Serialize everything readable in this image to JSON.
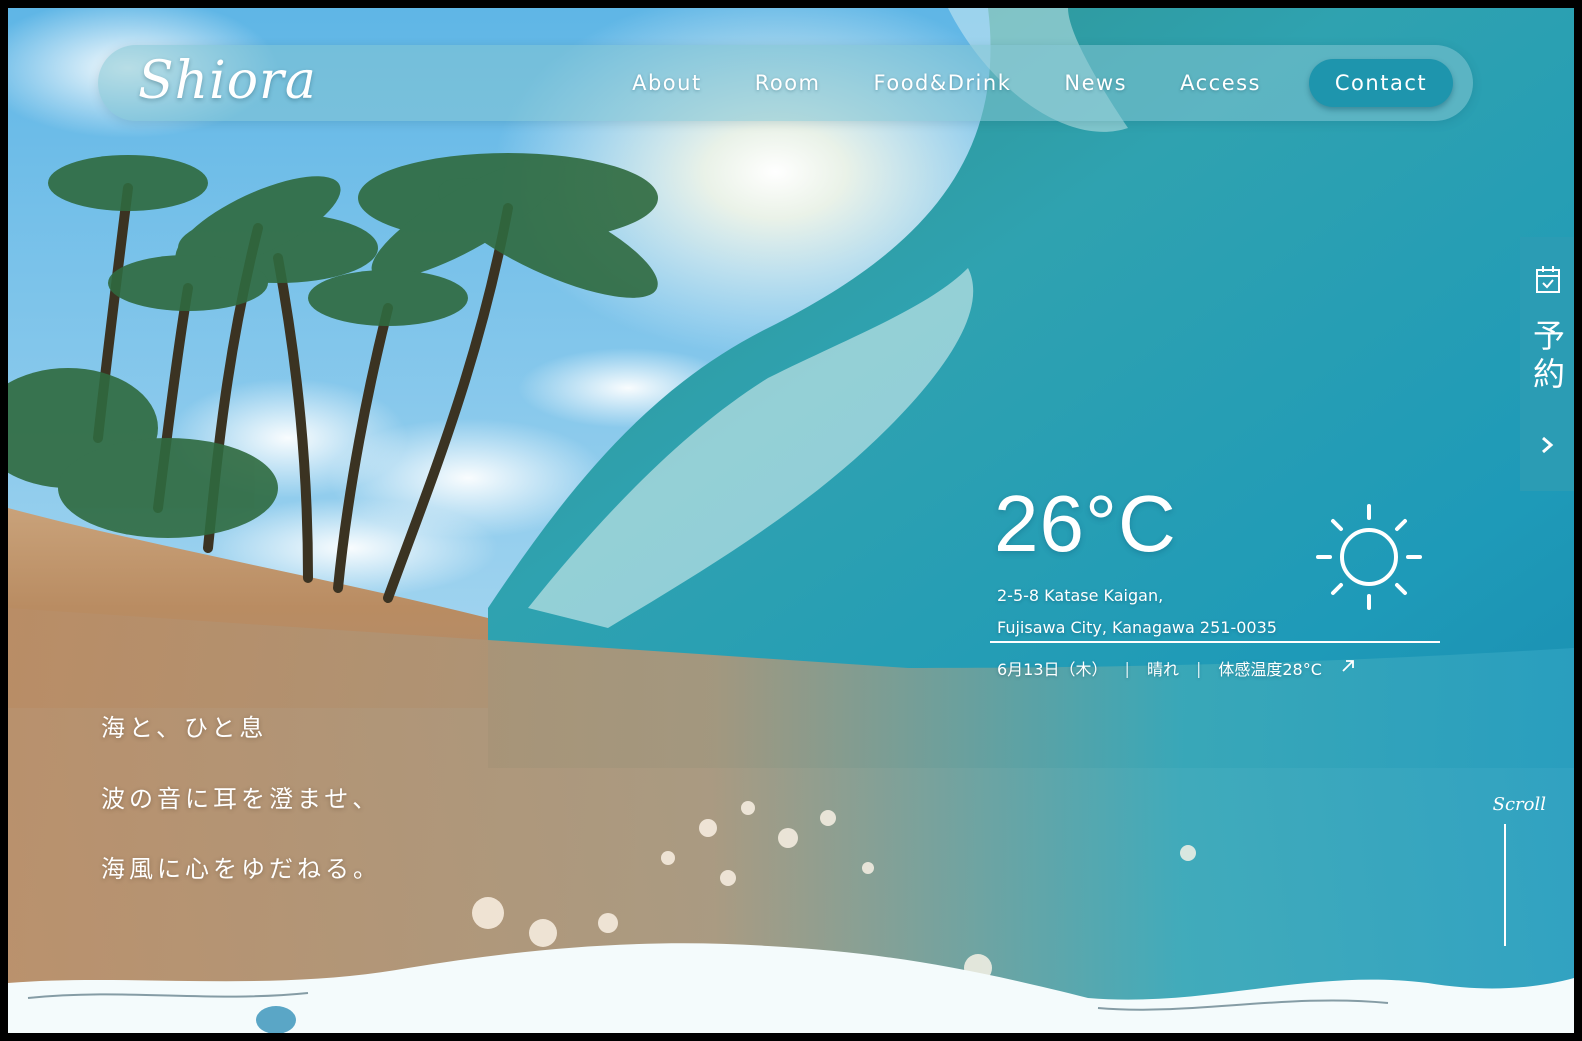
{
  "brand": {
    "logo_text": "Shiora"
  },
  "nav": {
    "items": [
      {
        "label": "About"
      },
      {
        "label": "Room"
      },
      {
        "label": "Food&Drink"
      },
      {
        "label": "News"
      },
      {
        "label": "Access"
      }
    ],
    "contact_label": "Contact"
  },
  "reserve": {
    "label": "予約",
    "icon": "calendar-check-icon",
    "arrow_icon": "chevron-right-icon"
  },
  "weather": {
    "temperature": "26°C",
    "icon": "sun-icon",
    "address_line1": "2-5-8 Katase Kaigan,",
    "address_line2": "Fujisawa City, Kanagawa 251-0035",
    "date": "6月13日（木）",
    "condition": "晴れ",
    "feels_like": "体感温度28°C",
    "separator": "|",
    "link_icon": "arrow-up-right-icon"
  },
  "hero_copy": {
    "line1": "海と、ひと息",
    "line2": "波の音に耳を澄ませ、",
    "line3": "海風に心をゆだねる。"
  },
  "scroll": {
    "label": "Scroll"
  },
  "colors": {
    "accent": "#1e95ad",
    "reserve_tab": "#2b9cb4",
    "nav_glass": "#84c4d2",
    "text": "#ffffff"
  }
}
